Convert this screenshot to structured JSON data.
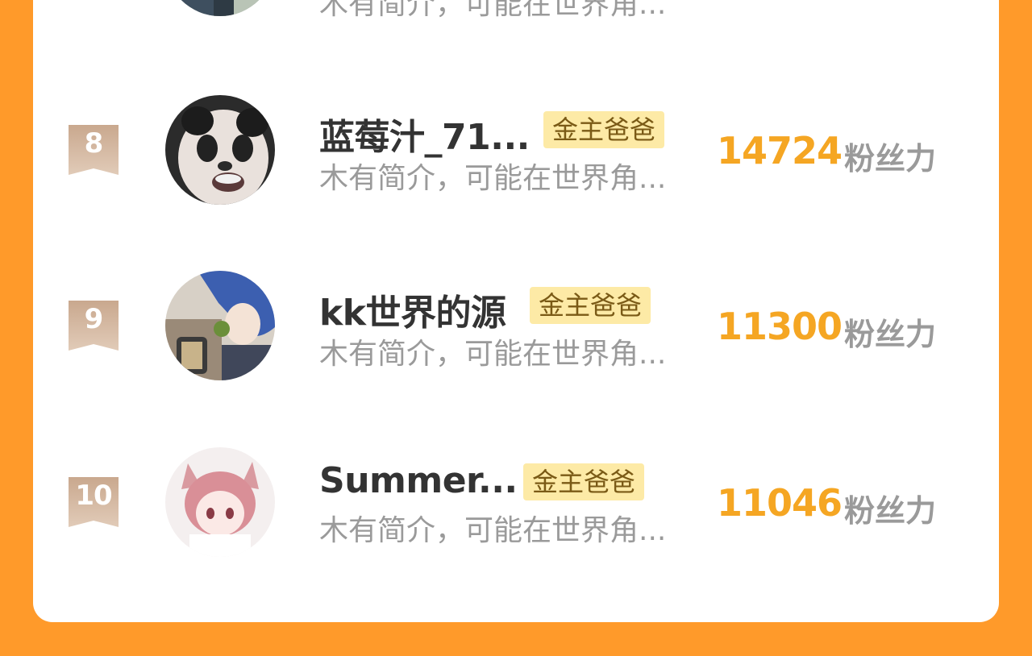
{
  "list": {
    "badge_label": "金主爸爸",
    "unit_label": "粉丝力",
    "partial_top_desc": "木有简介，可能在世界角...",
    "items": [
      {
        "rank": "8",
        "name": "蓝莓汁_71...",
        "desc": "木有简介，可能在世界角...",
        "score": "14724"
      },
      {
        "rank": "9",
        "name": "kk世界的源",
        "desc": "木有简介，可能在世界角...",
        "score": "11300"
      },
      {
        "rank": "10",
        "name": "Summer...",
        "desc": "木有简介，可能在世界角...",
        "score": "11046"
      }
    ]
  }
}
